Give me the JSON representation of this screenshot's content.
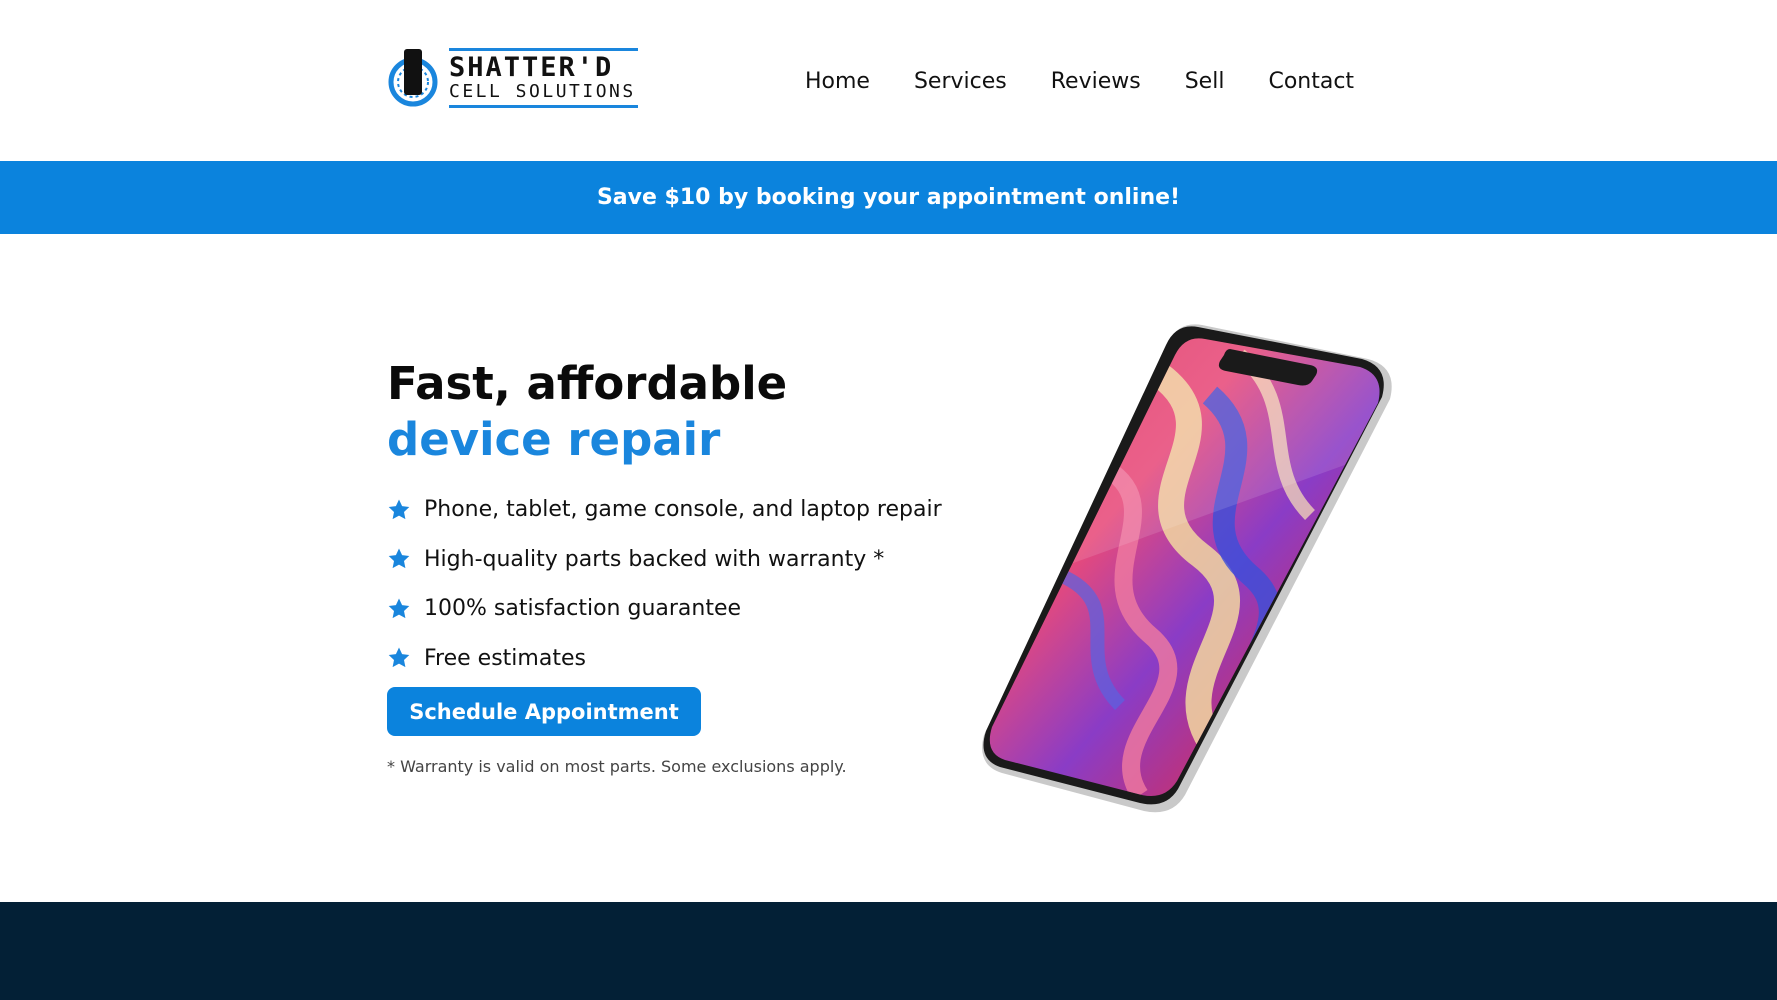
{
  "brand": {
    "name_line1": "SHATTER'D",
    "name_line2": "CELL SOLUTIONS",
    "accent_color": "#1a86dd"
  },
  "nav": {
    "items": [
      {
        "label": "Home"
      },
      {
        "label": "Services"
      },
      {
        "label": "Reviews"
      },
      {
        "label": "Sell"
      },
      {
        "label": "Contact"
      }
    ]
  },
  "promo": {
    "text": "Save $10 by booking your appointment online!",
    "background": "#0b83dd"
  },
  "hero": {
    "title_line1": "Fast, affordable",
    "title_line2": "device repair",
    "features": [
      {
        "icon": "star-icon",
        "text": "Phone, tablet, game console, and laptop repair"
      },
      {
        "icon": "star-icon",
        "text": "High-quality parts backed with warranty *"
      },
      {
        "icon": "star-icon",
        "text": "100% satisfaction guarantee"
      },
      {
        "icon": "star-icon",
        "text": "Free estimates"
      }
    ],
    "cta_label": "Schedule Appointment",
    "disclaimer": "* Warranty is valid on most parts. Some exclusions apply."
  },
  "footer_band": {
    "color": "#032036"
  }
}
